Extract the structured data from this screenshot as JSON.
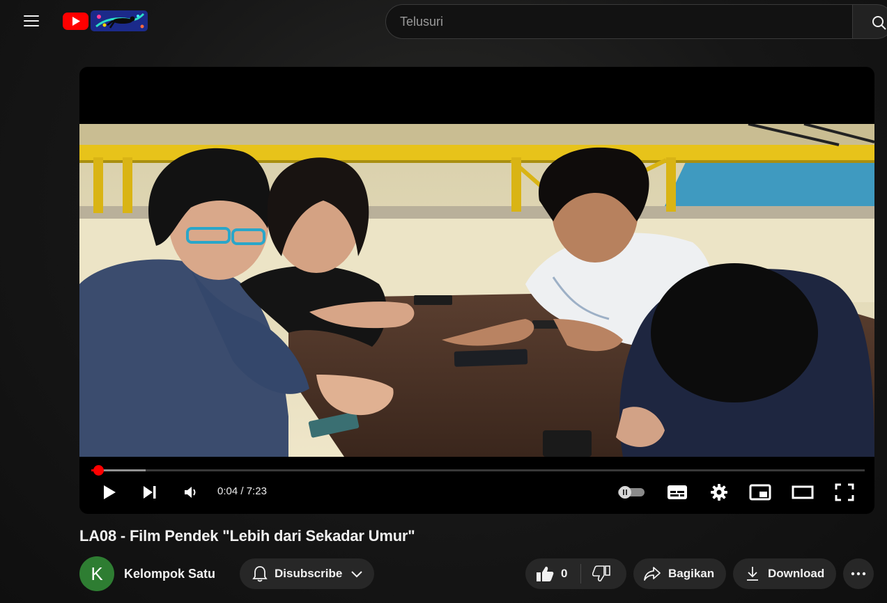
{
  "header": {
    "search_placeholder": "Telusuri"
  },
  "player": {
    "time_current": "0:04",
    "time_separator": "/",
    "time_total": "7:23",
    "progress_played_fraction": 0.009,
    "progress_buffered_fraction": 0.07,
    "autoplay_toggle": "off",
    "state": "paused"
  },
  "video": {
    "title": "LA08 - Film Pendek \"Lebih dari Sekadar Umur\""
  },
  "channel": {
    "avatar_letter": "K",
    "avatar_color": "#2e7d32",
    "name": "Kelompok Satu"
  },
  "actions": {
    "subscribe_label": "Disubscribe",
    "like_count": "0",
    "share_label": "Bagikan",
    "download_label": "Download"
  },
  "icons": {
    "menu": "hamburger-menu-icon",
    "search": "search-icon",
    "play": "play-icon",
    "next": "next-icon",
    "volume": "volume-icon",
    "autoplay": "autoplay-toggle-icon",
    "subtitles": "subtitles-icon",
    "settings": "gear-icon",
    "miniplayer": "miniplayer-icon",
    "theater": "theater-mode-icon",
    "fullscreen": "fullscreen-icon",
    "bell": "bell-icon",
    "chevron": "chevron-down-icon",
    "like": "thumbs-up-icon",
    "dislike": "thumbs-down-icon",
    "share": "share-icon",
    "download": "download-icon",
    "more": "more-horizontal-icon"
  },
  "colors": {
    "accent_red": "#ff0000",
    "pill_bg": "#272727",
    "page_bg": "#0f0f0f"
  }
}
